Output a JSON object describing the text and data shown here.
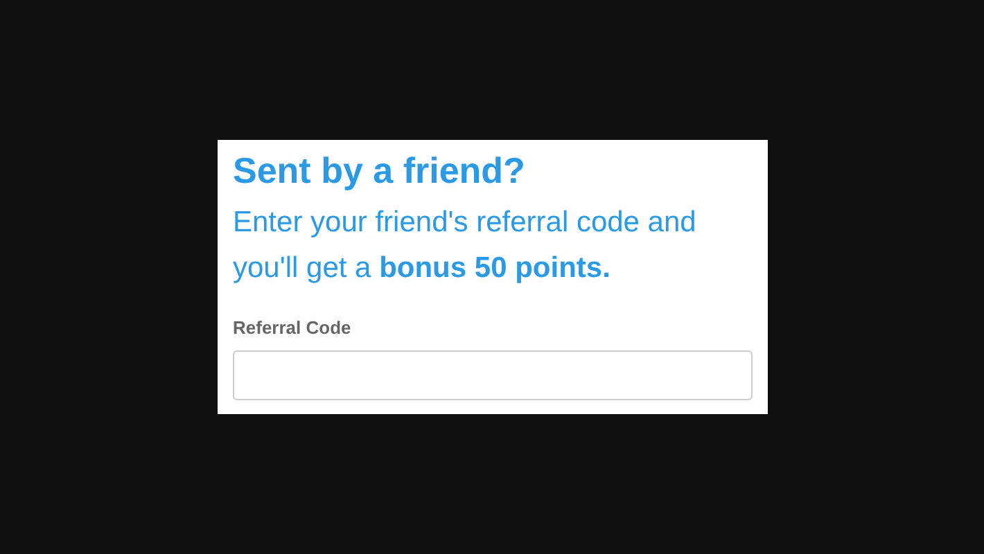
{
  "card": {
    "title": "Sent by a friend?",
    "text": "Enter your friend's referral code and you'll get a **bonus 50 points.**",
    "field": {
      "label": "Referral Code"
    }
  }
}
